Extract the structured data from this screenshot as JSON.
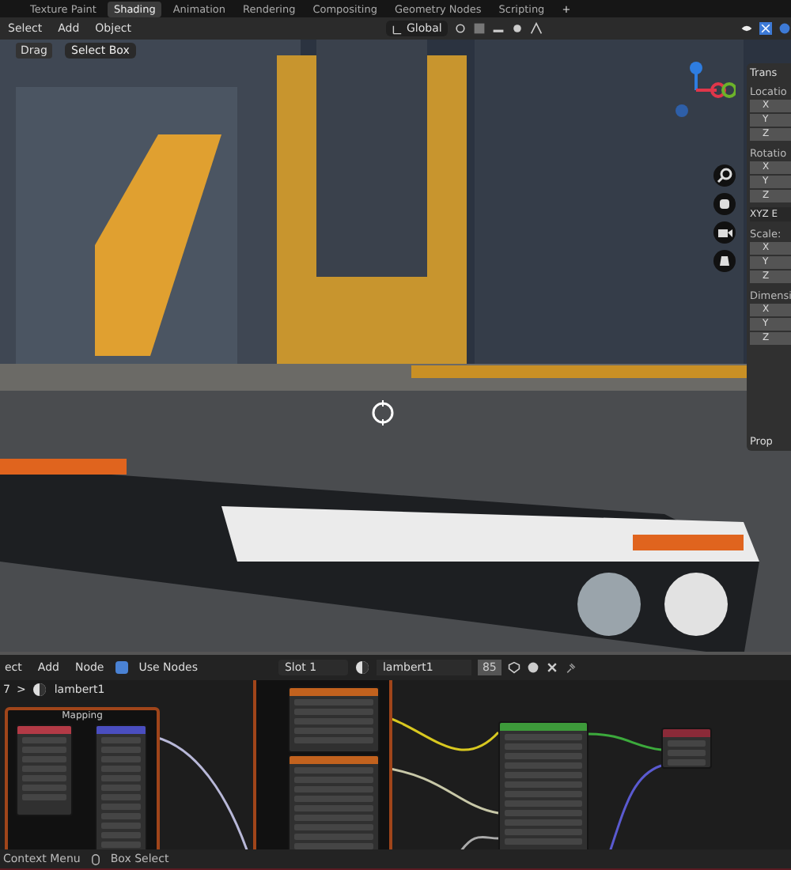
{
  "workspace_tabs": [
    {
      "label": "Texture Paint",
      "selected": false
    },
    {
      "label": "Shading",
      "selected": true
    },
    {
      "label": "Animation",
      "selected": false
    },
    {
      "label": "Rendering",
      "selected": false
    },
    {
      "label": "Compositing",
      "selected": false
    },
    {
      "label": "Geometry Nodes",
      "selected": false
    },
    {
      "label": "Scripting",
      "selected": false
    }
  ],
  "add_tab": "+",
  "viewport_header": {
    "menus": [
      "Select",
      "Add",
      "Object"
    ],
    "orientation": "Global"
  },
  "tool_settings": {
    "drag_label": "Drag",
    "select_mode": "Select Box"
  },
  "sidebar": {
    "panel": "Trans",
    "groups": [
      {
        "label": "Locatio",
        "axes": [
          "X",
          "Y",
          "Z"
        ]
      },
      {
        "label": "Rotatio",
        "axes": [
          "X",
          "Y",
          "Z"
        ],
        "mode": "XYZ E"
      },
      {
        "label": "Scale:",
        "axes": [
          "X",
          "Y",
          "Z"
        ]
      },
      {
        "label": "Dimensi",
        "axes": [
          "X",
          "Y",
          "Z"
        ]
      }
    ],
    "collapsed_panel": "Prop"
  },
  "node_header": {
    "menus": [
      "ect",
      "Add",
      "Node"
    ],
    "use_nodes": {
      "label": "Use Nodes",
      "checked": true
    },
    "slot": "Slot 1",
    "material": "lambert1",
    "users": "85"
  },
  "breadcrumb": {
    "prefix": "7",
    "separator": ">",
    "material": "lambert1"
  },
  "node_frames": [
    {
      "label": "Mapping",
      "nodes": [
        {
          "color": "#b33a46"
        },
        {
          "color": "#4a4ec0"
        }
      ]
    },
    {
      "nodes": [
        {
          "color": "#c2621e"
        },
        {
          "color": "#c2621e"
        }
      ]
    }
  ],
  "nodes": [
    {
      "color": "#3d9a3a"
    },
    {
      "color": "#8a2a38"
    }
  ],
  "status_bar": {
    "items": [
      "Context Menu",
      "Box Select"
    ]
  }
}
